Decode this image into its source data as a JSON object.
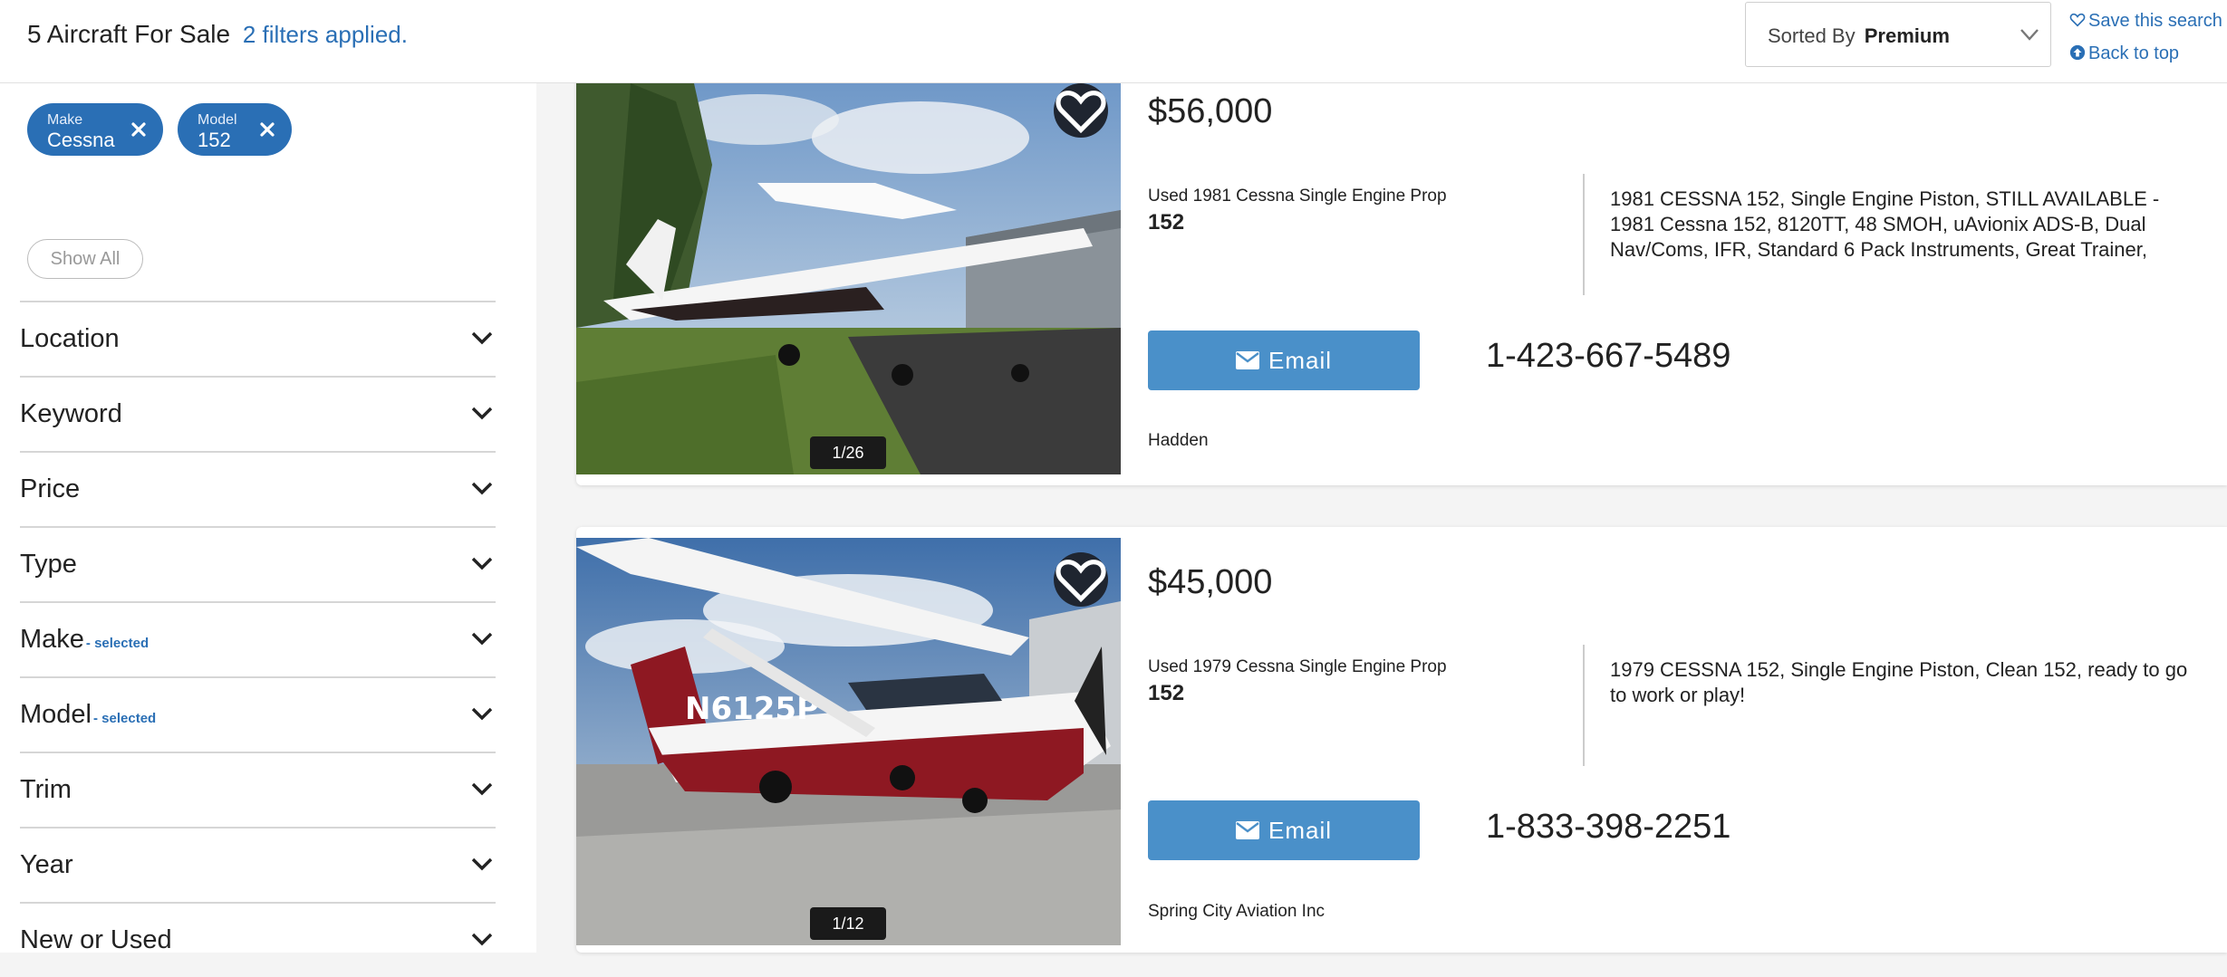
{
  "header": {
    "results_title": "5 Aircraft For Sale",
    "filters_applied": "2 filters applied.",
    "sort_label": "Sorted By",
    "sort_value": "Premium",
    "save_search": "Save this search",
    "back_to_top": "Back to top"
  },
  "sidebar": {
    "chips": [
      {
        "label": "Make",
        "value": "Cessna"
      },
      {
        "label": "Model",
        "value": "152"
      }
    ],
    "show_all": "Show All",
    "facets": [
      {
        "label": "Location",
        "selected": ""
      },
      {
        "label": "Keyword",
        "selected": ""
      },
      {
        "label": "Price",
        "selected": ""
      },
      {
        "label": "Type",
        "selected": ""
      },
      {
        "label": "Make",
        "selected": "- selected"
      },
      {
        "label": "Model",
        "selected": "- selected"
      },
      {
        "label": "Trim",
        "selected": ""
      },
      {
        "label": "Year",
        "selected": ""
      },
      {
        "label": "New or Used",
        "selected": ""
      }
    ]
  },
  "listings": [
    {
      "price": "$56,000",
      "subtitle": "Used 1981 Cessna Single Engine Prop",
      "model": "152",
      "description": "1981 CESSNA 152, Single Engine Piston, STILL AVAILABLE - 1981 Cessna 152, 8120TT, 48 SMOH, uAvionix ADS-B, Dual Nav/Coms, IFR, Standard 6 Pack Instruments, Great Trainer, Ready to Fly!View",
      "email_label": "Email",
      "phone": "1-423-667-5489",
      "seller": "Hadden",
      "photo_counter": "1/26"
    },
    {
      "price": "$45,000",
      "subtitle": "Used 1979 Cessna Single Engine Prop",
      "model": "152",
      "description": "1979 CESSNA 152, Single Engine Piston, Clean 152, ready to go to work or play!",
      "email_label": "Email",
      "phone": "1-833-398-2251",
      "seller": "Spring City Aviation Inc",
      "photo_counter": "1/12",
      "tail_number": "N6125P"
    }
  ],
  "colors": {
    "accent": "#2a6fb5",
    "email_button": "#4a90c9",
    "page_bg": "#f4f4f4"
  },
  "icons": [
    "heart-outline-icon",
    "circle-up-arrow-icon",
    "chevron-down-icon",
    "close-icon",
    "envelope-icon",
    "favorite-heart-icon"
  ]
}
